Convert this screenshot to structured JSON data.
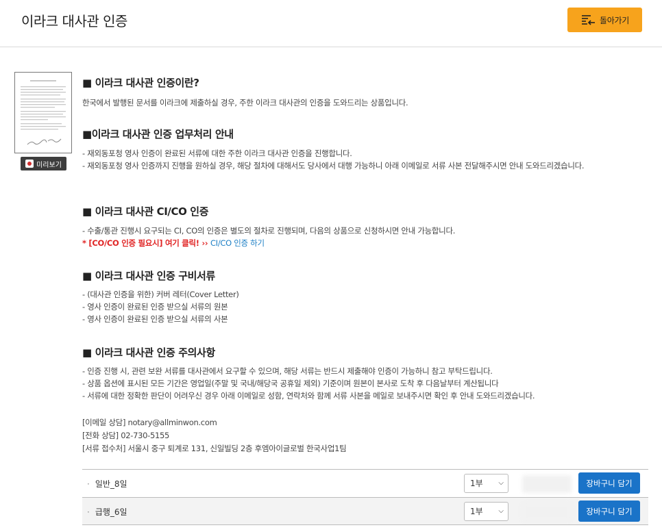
{
  "header": {
    "title": "이라크 대사관 인증",
    "back_label": "돌아가기"
  },
  "preview": {
    "label": "미리보기"
  },
  "sections": {
    "s1": {
      "title": "■ 이라크 대사관 인증이란?",
      "body": "한국에서 발행된 문서를 이라크에 제출하실 경우, 주한 이라크 대사관의 인증을 도와드리는 상품입니다."
    },
    "s2": {
      "title": "■이라크 대사관 인증 업무처리 안내",
      "l1": "- 재외동포청 영사 인증이 완료된 서류에 대한 주한 이라크 대사관 인증을 진행합니다.",
      "l2": "- 재외동포청 영사 인증까지 진행을 원하실 경우, 해당 절차에 대해서도 당사에서 대행 가능하니 아래 이메일로 서류 사본 전달해주시면 안내 도와드리겠습니다."
    },
    "s3": {
      "title": "■ 이라크 대사관 CI/CO 인증",
      "l1": "- 수출/통관 진행시 요구되는 CI, CO의 인증은 별도의 절차로 진행되며, 다음의 상품으로 신청하시면 안내 가능합니다.",
      "red": "* [CO/CO 인증 필요시] 여기 클릭! ›› ",
      "link": "CI/CO 인증 하기"
    },
    "s4": {
      "title": "■ 이라크 대사관 인증 구비서류",
      "l1": "- (대사관 인증을 위한) 커버 레터(Cover Letter)",
      "l2": "- 영사 인증이 완료된 인증 받으실 서류의 원본",
      "l3": "- 영사 인증이 완료된 인증 받으실 서류의 사본"
    },
    "s5": {
      "title": "■ 이라크 대사관 인증 주의사항",
      "l1": "- 인증 진행 시, 관련 보완 서류를 대사관에서 요구할 수 있으며, 해당 서류는 반드시 제출해야 인증이 가능하니 참고 부탁드립니다.",
      "l2": "- 상품 옵션에 표시된 모든 기간은 영업일(주말 및 국내/해당국 공휴일 제외) 기준이며 원본이 본사로 도착 후 다음날부터 계산됩니다",
      "l3": "- 서류에 대한 정확한 판단이 어려우신 경우 아래 이메일로 성함, 연락처와 함께 서류 사본을 메일로 보내주시면 확인 후 안내 도와드리겠습니다."
    }
  },
  "contact": {
    "email": "[이메일 상담] notary@allminwon.com",
    "phone": "[전화 상담] 02-730-5155",
    "address": "[서류 접수처] 서울시 중구 퇴계로 131, 신일빌딩 2층 후엠아이글로벌 한국사업1팀"
  },
  "options": [
    {
      "dot": "·",
      "name": "일반_8일",
      "qty": "1부",
      "cart": "장바구니 담기"
    },
    {
      "dot": "·",
      "name": "급행_6일",
      "qty": "1부",
      "cart": "장바구니 담기"
    }
  ],
  "colors": {
    "accent": "#f7a31c",
    "cart": "#1a73c8",
    "notice": "#e02424",
    "link": "#1d7fc5"
  }
}
